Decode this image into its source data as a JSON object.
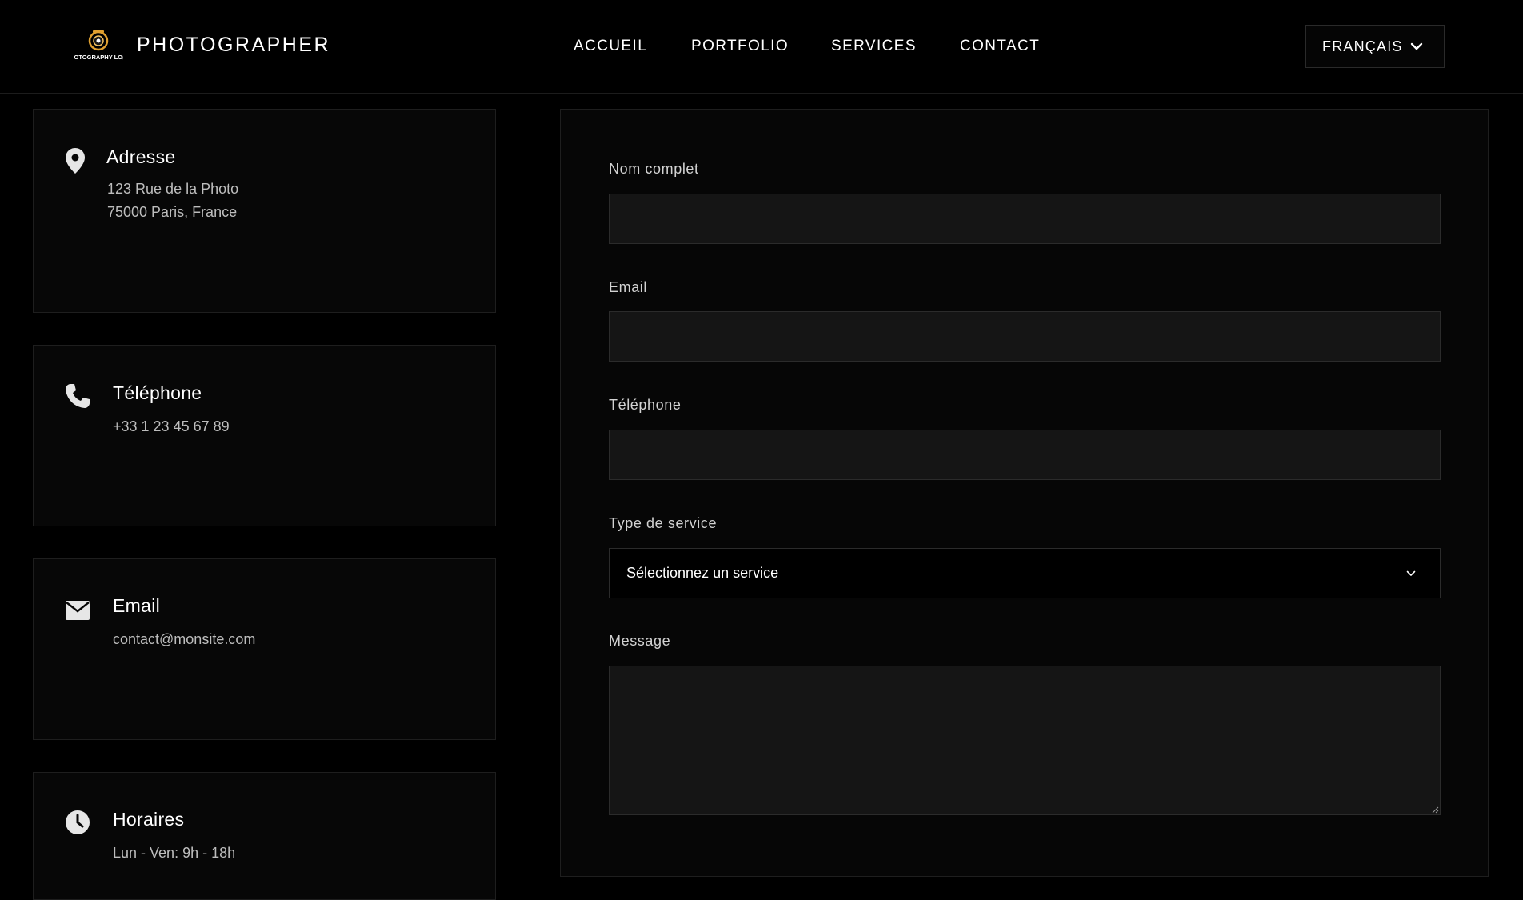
{
  "header": {
    "brand": "PHOTOGRAPHER",
    "logo_text": "IOTOGRAPHY LO(",
    "nav": [
      "ACCUEIL",
      "PORTFOLIO",
      "SERVICES",
      "CONTACT"
    ],
    "language": "FRANÇAIS",
    "accent_color": "#e0a030"
  },
  "info_cards": [
    {
      "icon": "location-pin-icon",
      "title": "Adresse",
      "lines": [
        "123 Rue de la Photo",
        "75000 Paris, France"
      ]
    },
    {
      "icon": "phone-icon",
      "title": "Téléphone",
      "lines": [
        "+33 1 23 45 67 89"
      ]
    },
    {
      "icon": "envelope-icon",
      "title": "Email",
      "lines": [
        "contact@monsite.com"
      ]
    },
    {
      "icon": "clock-icon",
      "title": "Horaires",
      "lines": [
        "Lun - Ven: 9h - 18h"
      ]
    }
  ],
  "form": {
    "fields": [
      {
        "label": "Nom complet",
        "value": ""
      },
      {
        "label": "Email",
        "value": ""
      },
      {
        "label": "Téléphone",
        "value": ""
      }
    ],
    "service": {
      "label": "Type de service",
      "selected": "Sélectionnez un service"
    },
    "message": {
      "label": "Message",
      "value": ""
    }
  }
}
